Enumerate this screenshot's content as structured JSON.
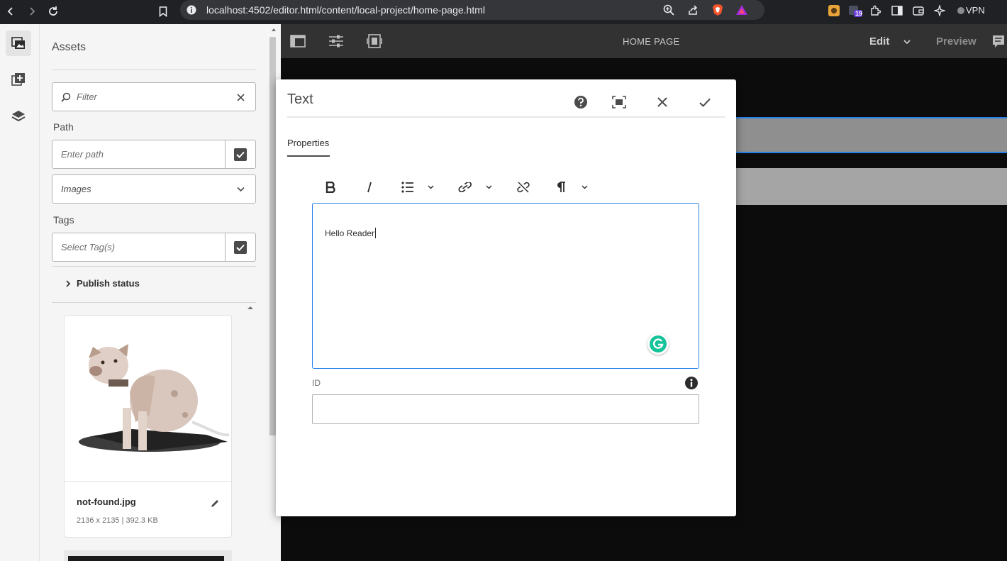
{
  "browser": {
    "url": "localhost:4502/editor.html/content/local-project/home-page.html",
    "vpn_label": "VPN",
    "extension_badge": "19"
  },
  "assets_panel": {
    "title": "Assets",
    "filter_placeholder": "Filter",
    "path_label": "Path",
    "path_placeholder": "Enter path",
    "type_select": "Images",
    "tags_label": "Tags",
    "tags_placeholder": "Select Tag(s)",
    "publish_status_label": "Publish status",
    "asset": {
      "name": "not-found.jpg",
      "meta": "2136 x 2135 | 392.3 KB"
    }
  },
  "editor": {
    "page_title": "HOME PAGE",
    "mode_label": "Edit",
    "preview_label": "Preview"
  },
  "dialog": {
    "title": "Text",
    "tab": "Properties",
    "rte_content": "Hello Reader",
    "id_label": "ID",
    "id_value": ""
  },
  "colors": {
    "accent": "#2680eb",
    "editor_bar": "#323232",
    "canvas": "#0c0c0c",
    "grammarly": "#15c39a"
  }
}
